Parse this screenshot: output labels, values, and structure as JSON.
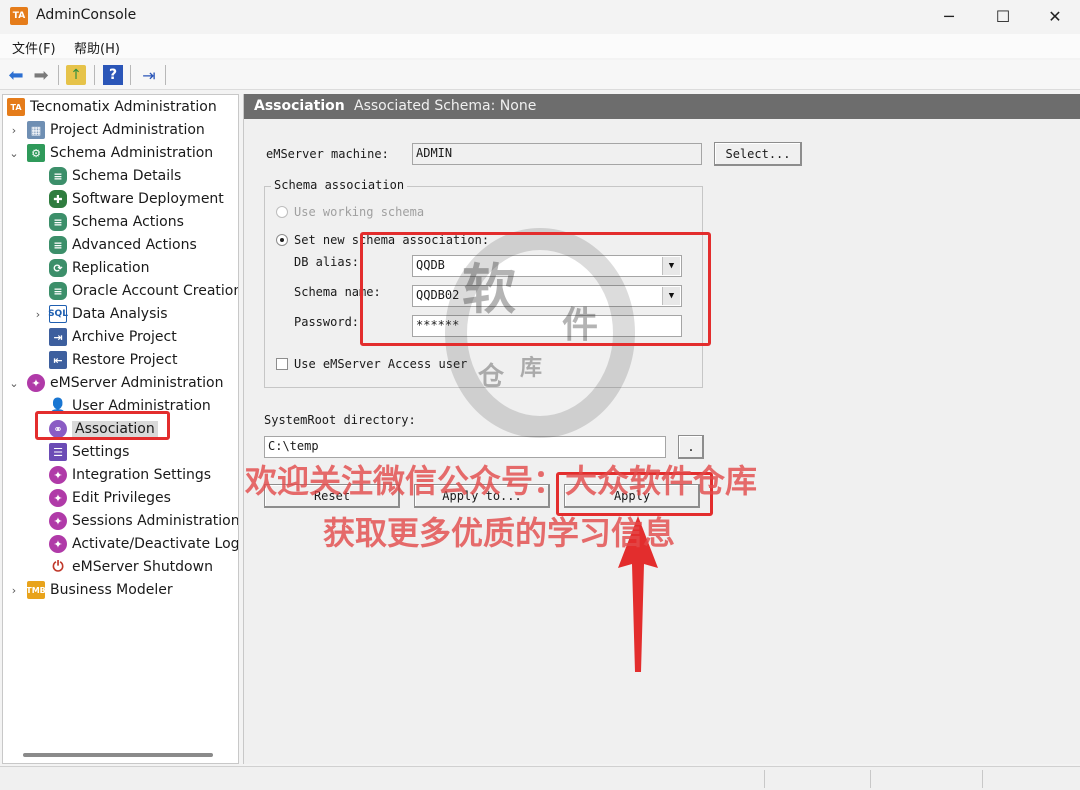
{
  "window": {
    "title": "AdminConsole",
    "icon_text": "TA"
  },
  "menu": {
    "file": "文件(F)",
    "help": "帮助(H)"
  },
  "tree": {
    "root": "Tecnomatix Administration",
    "project_admin": "Project Administration",
    "schema_admin": "Schema Administration",
    "schema_children": [
      "Schema Details",
      "Software Deployment",
      "Schema Actions",
      "Advanced Actions",
      "Replication",
      "Oracle Account Creation",
      "Data Analysis",
      "Archive Project",
      "Restore Project"
    ],
    "emserver_admin": "eMServer Administration",
    "emserver_children": [
      "User Administration",
      "Association",
      "Settings",
      "Integration Settings",
      "Edit Privileges",
      "Sessions Administration",
      "Activate/Deactivate Login",
      "eMServer Shutdown"
    ],
    "business_modeler": "Business Modeler",
    "icon_text": {
      "ta": "TA",
      "sql": "SQL",
      "bm": "TMB"
    }
  },
  "panel": {
    "title": "Association",
    "subtitle": "Associated Schema: None",
    "emserver_label": "eMServer machine:",
    "emserver_value": "ADMIN",
    "select_button": "Select...",
    "group_title": "Schema association",
    "use_working": "Use working schema",
    "set_new": "Set new schema association:",
    "db_alias_label": "DB alias:",
    "db_alias_value": "QQDB",
    "schema_name_label": "Schema name:",
    "schema_name_value": "QQDB02",
    "password_label": "Password:",
    "password_value": "******",
    "use_access_user": "Use eMServer Access user",
    "systemroot_label": "SystemRoot directory:",
    "systemroot_value": "C:\\temp",
    "browse_button": ".",
    "reset_button": "Reset",
    "apply_to_button": "Apply to...",
    "apply_button": "Apply"
  },
  "overlay": {
    "line1": "欢迎关注微信公众号：大众软件仓库",
    "line2": "获取更多优质的学习信息",
    "seal_chars": [
      "软",
      "件",
      "仓",
      "库"
    ]
  },
  "colors": {
    "annotation_red": "#e32d2d",
    "header_gray": "#6d6d6d",
    "app_orange": "#e57c1a"
  }
}
